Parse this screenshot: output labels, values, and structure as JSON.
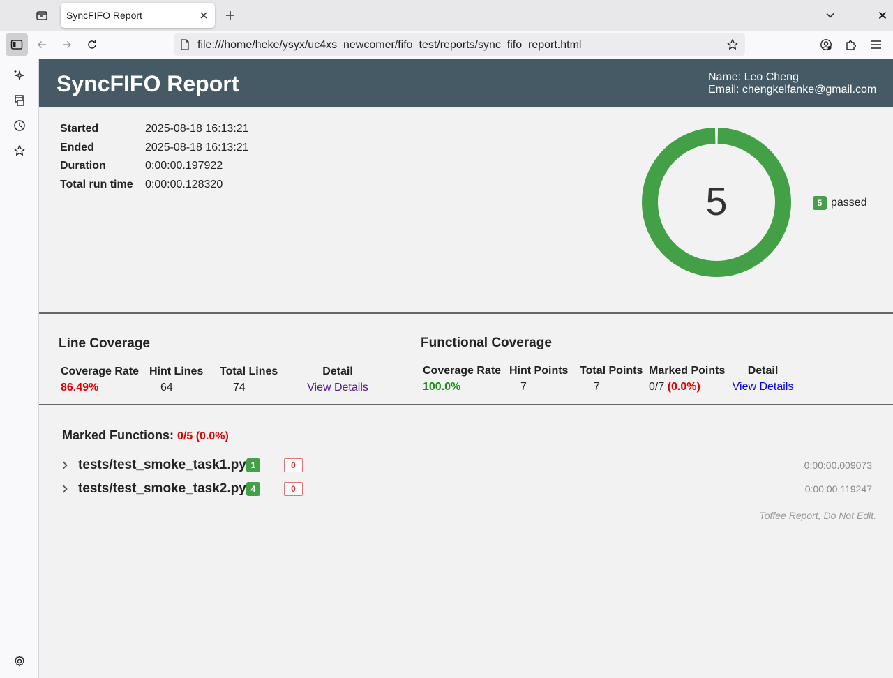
{
  "browser": {
    "tab_title": "SyncFIFO Report",
    "url": "file:///home/heke/ysyx/uc4xs_newcomer/fifo_test/reports/sync_fifo_report.html"
  },
  "report": {
    "title": "SyncFIFO Report",
    "author_name": "Name: Leo Cheng",
    "author_email": "Email: chengkelfanke@gmail.com"
  },
  "summary": {
    "started_label": "Started",
    "started": "2025-08-18 16:13:21",
    "ended_label": "Ended",
    "ended": "2025-08-18 16:13:21",
    "duration_label": "Duration",
    "duration": "0:00:00.197922",
    "total_label": "Total run time",
    "total_run_time": "0:00:00.128320"
  },
  "chart_data": {
    "type": "pie",
    "center_value": "5",
    "slices": [
      {
        "label": "passed",
        "value": 5,
        "color": "#43a047"
      }
    ],
    "legend_position": "right"
  },
  "line_coverage": {
    "title": "Line Coverage",
    "headers": [
      "Coverage Rate",
      "Hint Lines",
      "Total Lines",
      "Detail"
    ],
    "rate": "86.49%",
    "hint_lines": "64",
    "total_lines": "74",
    "detail_link": "View Details"
  },
  "functional_coverage": {
    "title": "Functional Coverage",
    "headers": [
      "Coverage Rate",
      "Hint Points",
      "Total Points",
      "Marked Points",
      "Detail"
    ],
    "rate": "100.0%",
    "hint_points": "7",
    "total_points": "7",
    "marked_points": "0/7",
    "marked_pct": "(0.0%)",
    "detail_link": "View Details"
  },
  "marked_functions": {
    "label": "Marked Functions:",
    "value": "0/5 (0.0%)"
  },
  "tests": [
    {
      "name": "tests/test_smoke_task1.py",
      "passed": "1",
      "failed": "0",
      "time": "0:00:00.009073"
    },
    {
      "name": "tests/test_smoke_task2.py",
      "passed": "4",
      "failed": "0",
      "time": "0:00:00.119247"
    }
  ],
  "footer": "Toffee Report, Do Not Edit.",
  "colors": {
    "header_bg": "#455a64",
    "pass_green": "#43a047",
    "fail_red": "#e00000"
  }
}
